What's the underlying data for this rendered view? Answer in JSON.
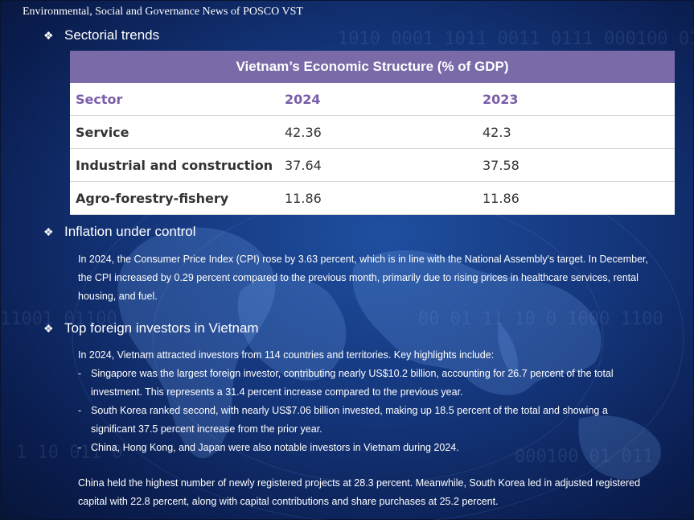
{
  "header": {
    "title": "Environmental,  Social and Governance News of POSCO VST"
  },
  "sections": {
    "sectorial": {
      "heading": "Sectorial trends"
    },
    "inflation": {
      "heading": "Inflation under control",
      "text": "In 2024, the Consumer Price Index (CPI) rose by 3.63 percent, which is in line with the National Assembly's target. In December, the CPI increased by 0.29 percent compared to the previous month, primarily due to rising prices in healthcare services, rental housing, and fuel."
    },
    "investors": {
      "heading": "Top foreign investors in Vietnam",
      "intro": "In 2024, Vietnam attracted investors from 114 countries and territories. Key highlights include:",
      "bullets": [
        "Singapore was the largest foreign investor, contributing nearly US$10.2 billion, accounting for 26.7 percent of the total investment. This represents a 31.4 percent increase compared to the previous year.",
        "South Korea ranked second, with nearly US$7.06 billion invested, making up 18.5 percent of the total and showing a significant 37.5 percent increase from the prior year.",
        "China, Hong Kong, and Japan were also notable investors in Vietnam during 2024."
      ],
      "closing": "China held the highest number of newly registered projects at 28.3 percent. Meanwhile, South Korea led in adjusted registered capital with 22.8 percent, along with capital contributions and share purchases at 25.2 percent."
    }
  },
  "chart_data": {
    "type": "table",
    "title": "Vietnam’s Economic Structure (% of GDP)",
    "columns": [
      "Sector",
      "2024",
      "2023"
    ],
    "rows": [
      [
        "Service",
        "42.36",
        "42.3"
      ],
      [
        "Industrial and construction",
        "37.64",
        "37.58"
      ],
      [
        "Agro-forestry-fishery",
        "11.86",
        "11.86"
      ]
    ]
  },
  "icons": {
    "bullet": "diamond-bullet-icon",
    "dash": "-"
  },
  "colors": {
    "table_header": "#7a6aa8",
    "column_header_text": "#7a5ca8",
    "background": "#14357a"
  }
}
